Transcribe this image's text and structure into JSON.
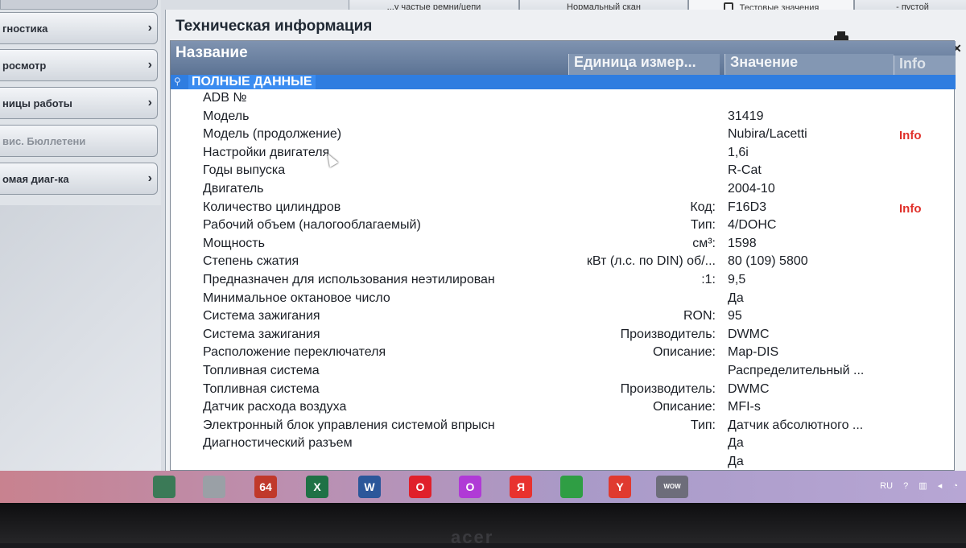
{
  "sidebar": {
    "items": [
      {
        "label": "гностика",
        "chevron": "›",
        "dim": false
      },
      {
        "label": "росмотр",
        "chevron": "›",
        "dim": false
      },
      {
        "label": "ницы работы",
        "chevron": "›",
        "dim": false
      },
      {
        "label": "вис. Бюллетени",
        "chevron": "",
        "dim": true
      },
      {
        "label": "омая диаг-ка",
        "chevron": "›",
        "dim": false
      }
    ]
  },
  "tabs": [
    {
      "label": "...у частые ремни/цепи"
    },
    {
      "label": "Нормальный скан"
    },
    {
      "label": "Тестовые значения"
    },
    {
      "label": "- пустой"
    }
  ],
  "panel": {
    "title": "Техническая информация"
  },
  "table": {
    "headers": {
      "name": "Название",
      "unit": "Единица измер...",
      "value": "Значение",
      "info": "Info"
    },
    "group": "ПОЛНЫЕ ДАННЫЕ",
    "rows": [
      {
        "name": "ADB №",
        "unit": "",
        "value": "",
        "info": ""
      },
      {
        "name": "Модель",
        "unit": "",
        "value": "31419",
        "info": ""
      },
      {
        "name": "Модель (продолжение)",
        "unit": "",
        "value": "Nubira/Lacetti",
        "info": "Info"
      },
      {
        "name": "Настройки двигателя",
        "unit": "",
        "value": "1,6i",
        "info": ""
      },
      {
        "name": "Годы выпуска",
        "unit": "",
        "value": "R-Cat",
        "info": ""
      },
      {
        "name": "Двигатель",
        "unit": "",
        "value": "2004-10",
        "info": ""
      },
      {
        "name": "Количество цилиндров",
        "unit": "Код:",
        "value": "F16D3",
        "info": "Info"
      },
      {
        "name": "Рабочий объем (налогооблагаемый)",
        "unit": "Тип:",
        "value": "4/DOHC",
        "info": ""
      },
      {
        "name": "Мощность",
        "unit": "см³:",
        "value": "1598",
        "info": ""
      },
      {
        "name": "Степень сжатия",
        "unit": "кВт (л.с. по DIN) об/...",
        "value": "80 (109)  5800",
        "info": ""
      },
      {
        "name": "Предназначен для использования неэтилирован",
        "unit": ":1:",
        "value": "9,5",
        "info": ""
      },
      {
        "name": "Минимальное октановое число",
        "unit": "",
        "value": "Да",
        "info": ""
      },
      {
        "name": "Система зажигания",
        "unit": "RON:",
        "value": "95",
        "info": ""
      },
      {
        "name": "Система зажигания",
        "unit": "Производитель:",
        "value": "DWMC",
        "info": ""
      },
      {
        "name": "Расположение переключателя",
        "unit": "Описание:",
        "value": "Map-DIS",
        "info": ""
      },
      {
        "name": "Топливная система",
        "unit": "",
        "value": "Распределительный ...",
        "info": ""
      },
      {
        "name": "Топливная система",
        "unit": "Производитель:",
        "value": "DWMC",
        "info": ""
      },
      {
        "name": "Датчик расхода воздуха",
        "unit": "Описание:",
        "value": "MFI-s",
        "info": ""
      },
      {
        "name": "Электронный блок управления системой впрысн",
        "unit": "Тип:",
        "value": "Датчик абсолютного ...",
        "info": ""
      },
      {
        "name": "Диагностический разъем",
        "unit": "",
        "value": "Да",
        "info": ""
      },
      {
        "name": "",
        "unit": "",
        "value": "Да",
        "info": ""
      }
    ]
  },
  "taskbar": {
    "icons": [
      {
        "name": "taskmgr-icon",
        "label": "",
        "color": "#3b7a57"
      },
      {
        "name": "calculator-icon",
        "label": "",
        "color": "#9aa0a6"
      },
      {
        "name": "app64-icon",
        "label": "64",
        "color": "#c0392b"
      },
      {
        "name": "excel-icon",
        "label": "X",
        "color": "#1e7145"
      },
      {
        "name": "word-icon",
        "label": "W",
        "color": "#2b579a"
      },
      {
        "name": "opera-icon",
        "label": "O",
        "color": "#e0202b"
      },
      {
        "name": "opera-gx-icon",
        "label": "O",
        "color": "#b03ad6"
      },
      {
        "name": "yandex-icon",
        "label": "Я",
        "color": "#e8322f"
      },
      {
        "name": "chrome-icon",
        "label": "",
        "color": "#2f9e44"
      },
      {
        "name": "yandex-browser-icon",
        "label": "Y",
        "color": "#e03a2f"
      },
      {
        "name": "wow-icon",
        "label": "WOW",
        "color": "#6d6d7a"
      }
    ],
    "lang": "RU"
  },
  "bezel": {
    "brand": "acer"
  }
}
